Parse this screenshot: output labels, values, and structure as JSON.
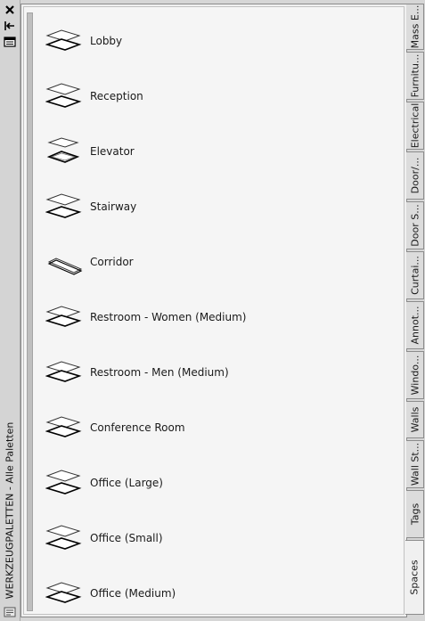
{
  "window": {
    "title": "WERKZEUGPALETTEN - Alle Paletten"
  },
  "controls": {
    "close_icon": "close-icon",
    "autohide_icon": "autohide-icon",
    "properties_icon": "properties-icon"
  },
  "tools": [
    {
      "label": "Lobby",
      "icon": "space-lobby-icon"
    },
    {
      "label": "Reception",
      "icon": "space-reception-icon"
    },
    {
      "label": "Elevator",
      "icon": "space-elevator-icon"
    },
    {
      "label": "Stairway",
      "icon": "space-stairway-icon"
    },
    {
      "label": "Corridor",
      "icon": "space-corridor-icon"
    },
    {
      "label": "Restroom - Women (Medium)",
      "icon": "space-restroom-women-icon"
    },
    {
      "label": "Restroom - Men (Medium)",
      "icon": "space-restroom-men-icon"
    },
    {
      "label": "Conference Room",
      "icon": "space-conference-icon"
    },
    {
      "label": "Office (Large)",
      "icon": "space-office-large-icon"
    },
    {
      "label": "Office (Small)",
      "icon": "space-office-small-icon"
    },
    {
      "label": "Office (Medium)",
      "icon": "space-office-medium-icon"
    }
  ],
  "tabs": [
    {
      "label": "Mass E..."
    },
    {
      "label": "Furnitu..."
    },
    {
      "label": "Electrical"
    },
    {
      "label": "Door/..."
    },
    {
      "label": "Door S..."
    },
    {
      "label": "Curtai..."
    },
    {
      "label": "Annot..."
    },
    {
      "label": "Windo..."
    },
    {
      "label": "Walls"
    },
    {
      "label": "Wall St..."
    },
    {
      "label": "Tags"
    },
    {
      "label": "Spaces",
      "active": true
    }
  ]
}
